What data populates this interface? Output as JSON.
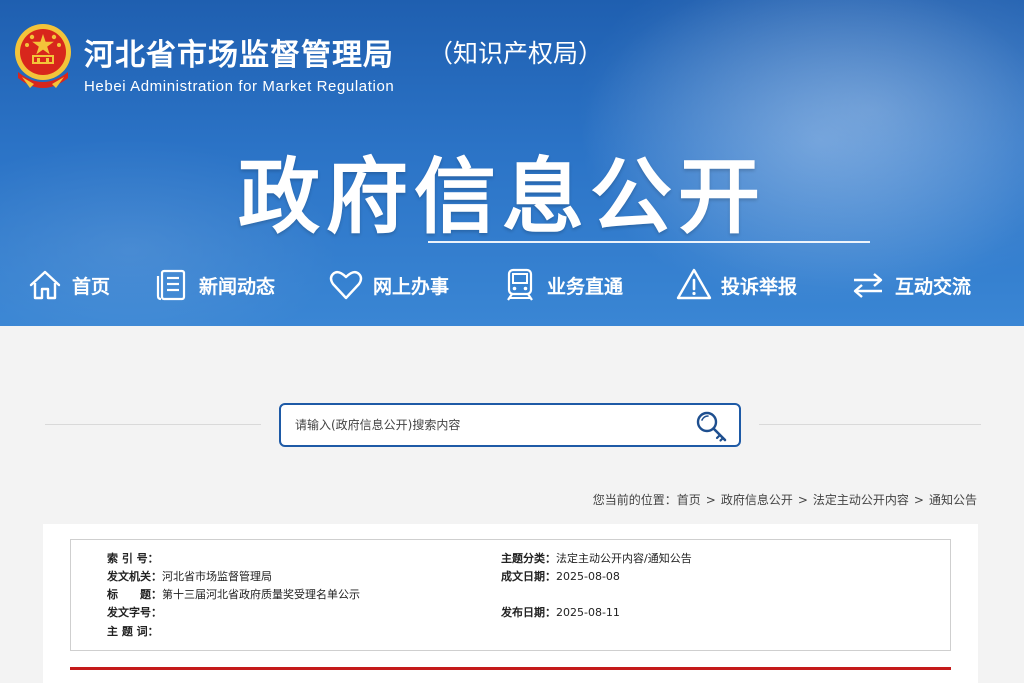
{
  "header": {
    "site_name": "河北省市场监督管理局",
    "site_sub": "（知识产权局）",
    "site_en": "Hebei Administration for Market Regulation",
    "big_title": "政府信息公开"
  },
  "nav": [
    {
      "label": "首页",
      "icon": "home-icon"
    },
    {
      "label": "新闻动态",
      "icon": "document-icon"
    },
    {
      "label": "网上办事",
      "icon": "heart-icon"
    },
    {
      "label": "业务直通",
      "icon": "train-icon"
    },
    {
      "label": "投诉举报",
      "icon": "warning-icon"
    },
    {
      "label": "互动交流",
      "icon": "exchange-icon"
    }
  ],
  "search": {
    "placeholder": "请输入(政府信息公开)搜索内容",
    "button_icon": "key-search-icon"
  },
  "breadcrumb": {
    "prefix": "您当前的位置：",
    "items": [
      "首页",
      "政府信息公开",
      "法定主动公开内容",
      "通知公告"
    ],
    "separator": ">"
  },
  "meta": {
    "index_label": "索 引 号：",
    "index_value": "",
    "topic_label": "主题分类：",
    "topic_value": "法定主动公开内容/通知公告",
    "issuer_label": "发文机关：",
    "issuer_value": "河北省市场监督管理局",
    "created_label": "成文日期：",
    "created_value": "2025-08-08",
    "title_label": "标　　题：",
    "title_value": "第十三届河北省政府质量奖受理名单公示",
    "docno_label": "发文字号：",
    "docno_value": "",
    "published_label": "发布日期：",
    "published_value": "2025-08-11",
    "keywords_label": "主 题 词：",
    "keywords_value": ""
  },
  "colors": {
    "banner_top": "#1f5fb0",
    "banner_bottom": "#3a86d4",
    "search_border": "#1e5aa6",
    "divider_red": "#c41a1a",
    "emblem_red": "#d8261c",
    "emblem_gold": "#f3c43a"
  }
}
